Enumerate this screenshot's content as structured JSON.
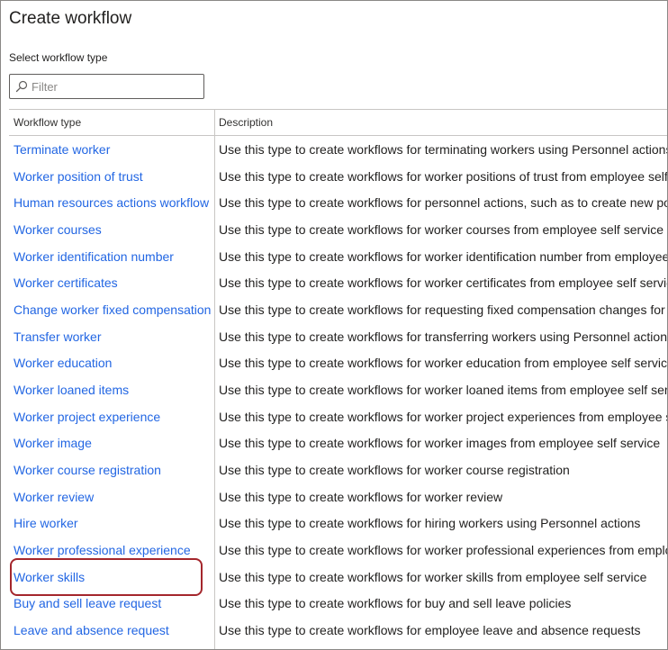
{
  "header": {
    "title": "Create workflow"
  },
  "filter": {
    "label": "Select workflow type",
    "placeholder": "Filter",
    "value": ""
  },
  "table": {
    "columns": {
      "type": "Workflow type",
      "description": "Description"
    },
    "rows": [
      {
        "type": "Terminate worker",
        "description": "Use this type to create workflows for terminating workers using Personnel actions"
      },
      {
        "type": "Worker position of trust",
        "description": "Use this type to create workflows for worker positions of trust from employee self service"
      },
      {
        "type": "Human resources actions workflow",
        "description": "Use this type to create workflows for personnel actions, such as to create new positions"
      },
      {
        "type": "Worker courses",
        "description": "Use this type to create workflows for worker courses from employee self service"
      },
      {
        "type": "Worker identification number",
        "description": "Use this type to create workflows for worker identification number from employee self service"
      },
      {
        "type": "Worker certificates",
        "description": "Use this type to create workflows for worker certificates from employee self service"
      },
      {
        "type": "Change worker fixed compensation",
        "description": "Use this type to create workflows for requesting fixed compensation changes for workers"
      },
      {
        "type": "Transfer worker",
        "description": "Use this type to create workflows for transferring workers using Personnel actions"
      },
      {
        "type": "Worker education",
        "description": "Use this type to create workflows for worker education from employee self service"
      },
      {
        "type": "Worker loaned items",
        "description": "Use this type to create workflows for worker loaned items from employee self service"
      },
      {
        "type": "Worker project experience",
        "description": "Use this type to create workflows for worker project experiences from employee self service"
      },
      {
        "type": "Worker image",
        "description": "Use this type to create workflows for worker images from employee self service"
      },
      {
        "type": "Worker course registration",
        "description": "Use this type to create workflows for worker course registration"
      },
      {
        "type": "Worker review",
        "description": "Use this type to create workflows for worker review"
      },
      {
        "type": "Hire worker",
        "description": "Use this type to create workflows for hiring workers using Personnel actions"
      },
      {
        "type": "Worker professional experience",
        "description": "Use this type to create workflows for worker professional experiences from employee self service"
      },
      {
        "type": "Worker skills",
        "description": "Use this type to create workflows for worker skills from employee self service"
      },
      {
        "type": "Buy and sell leave request",
        "description": "Use this type to create workflows for buy and sell leave policies"
      },
      {
        "type": "Leave and absence request",
        "description": "Use this type to create workflows for employee leave and absence requests"
      }
    ]
  },
  "colors": {
    "link": "#2266e3",
    "highlight": "#a4262c",
    "border": "#c8c6c4"
  },
  "icons": {
    "filter": "search-icon"
  }
}
